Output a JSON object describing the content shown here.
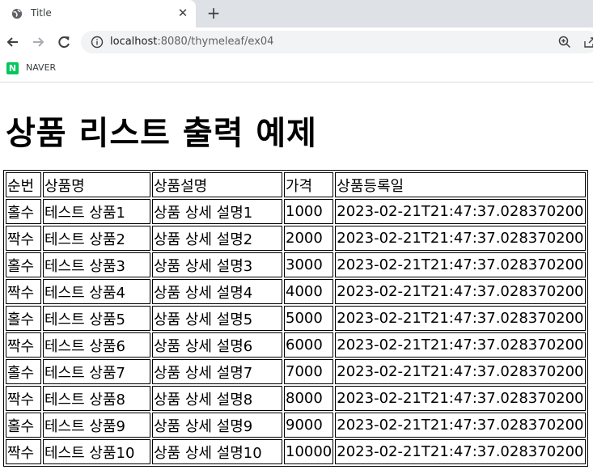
{
  "browser": {
    "tab_title": "Title",
    "new_tab_symbol": "+",
    "close_symbol": "✕",
    "url_host": "localhost",
    "url_rest": ":8080/thymeleaf/ex04",
    "bookmarks": [
      {
        "icon": "naver-icon",
        "icon_letter": "N",
        "label": "NAVER"
      }
    ]
  },
  "page": {
    "heading": "상품 리스트 출력 예제"
  },
  "table": {
    "headers": [
      "순번",
      "상품명",
      "상품설명",
      "가격",
      "상품등록일"
    ],
    "rows": [
      [
        "홀수",
        "테스트 상품1",
        "상품 상세 설명1",
        "1000",
        "2023-02-21T21:47:37.028370200"
      ],
      [
        "짝수",
        "테스트 상품2",
        "상품 상세 설명2",
        "2000",
        "2023-02-21T21:47:37.028370200"
      ],
      [
        "홀수",
        "테스트 상품3",
        "상품 상세 설명3",
        "3000",
        "2023-02-21T21:47:37.028370200"
      ],
      [
        "짝수",
        "테스트 상품4",
        "상품 상세 설명4",
        "4000",
        "2023-02-21T21:47:37.028370200"
      ],
      [
        "홀수",
        "테스트 상품5",
        "상품 상세 설명5",
        "5000",
        "2023-02-21T21:47:37.028370200"
      ],
      [
        "짝수",
        "테스트 상품6",
        "상품 상세 설명6",
        "6000",
        "2023-02-21T21:47:37.028370200"
      ],
      [
        "홀수",
        "테스트 상품7",
        "상품 상세 설명7",
        "7000",
        "2023-02-21T21:47:37.028370200"
      ],
      [
        "짝수",
        "테스트 상품8",
        "상품 상세 설명8",
        "8000",
        "2023-02-21T21:47:37.028370200"
      ],
      [
        "홀수",
        "테스트 상품9",
        "상품 상세 설명9",
        "9000",
        "2023-02-21T21:47:37.028370200"
      ],
      [
        "짝수",
        "테스트 상품10",
        "상품 상세 설명10",
        "10000",
        "2023-02-21T21:47:37.028370200"
      ]
    ]
  }
}
